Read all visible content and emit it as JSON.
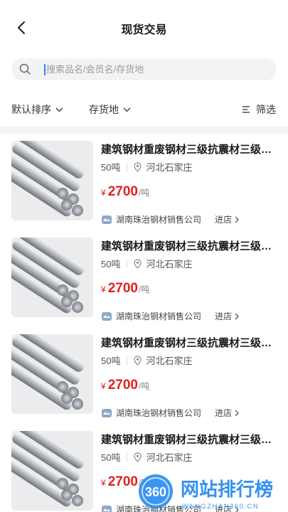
{
  "header": {
    "title": "现货交易"
  },
  "search": {
    "placeholder": "搜索品名/会员名/存货地"
  },
  "filters": {
    "sort_label": "默认排序",
    "location_label": "存货地",
    "screen_label": "筛选"
  },
  "products": [
    {
      "title": "建筑钢材重废钢材三级抗震材三级抗震材",
      "quantity": "50吨",
      "location": "河北石家庄",
      "currency": "¥",
      "price": "2700",
      "unit": "/吨",
      "shop": "湖南珠治钢材销售公司",
      "enter": "进店"
    },
    {
      "title": "建筑钢材重废钢材三级抗震材三级抗震材",
      "quantity": "50吨",
      "location": "河北石家庄",
      "currency": "¥",
      "price": "2700",
      "unit": "/吨",
      "shop": "湖南珠治钢材销售公司",
      "enter": "进店"
    },
    {
      "title": "建筑钢材重废钢材三级抗震材三级抗震材",
      "quantity": "50吨",
      "location": "河北石家庄",
      "currency": "¥",
      "price": "2700",
      "unit": "/吨",
      "shop": "湖南珠治钢材销售公司",
      "enter": "进店"
    },
    {
      "title": "建筑钢材重废钢材三级抗震材三级抗震材",
      "quantity": "50吨",
      "location": "河北石家庄",
      "currency": "¥",
      "price": "2700",
      "unit": "/吨",
      "shop": "湖南珠治钢材销售公司",
      "enter": "进店"
    }
  ],
  "watermark": {
    "text": "网站排行榜",
    "sub": "WANGZHAN360.CN",
    "badge": "360"
  },
  "colors": {
    "price": "#e02020",
    "accent": "#3a7bff",
    "watermark": "#2a8cf0"
  }
}
